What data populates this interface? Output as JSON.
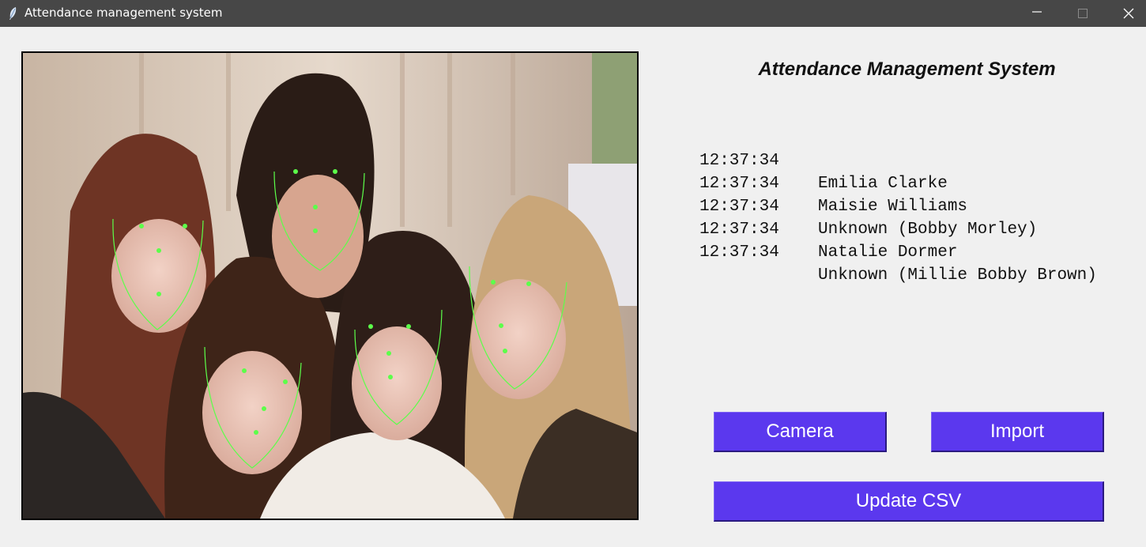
{
  "window": {
    "title": "Attendance management system",
    "icon": "feather-icon",
    "controls": [
      "minimize-icon",
      "maximize-icon",
      "close-icon"
    ]
  },
  "colors": {
    "titlebar": "#474747",
    "background": "#f0f0f0",
    "button": "#5b38ee",
    "button_text": "#ffffff",
    "landmarks": "#5cff4a"
  },
  "photo": {
    "subject": "group photo with facial landmarks detected",
    "faces_detected": 5
  },
  "main": {
    "heading": "Attendance Management System"
  },
  "attendance_log": [
    {
      "time": "12:37:34",
      "name": "Emilia Clarke"
    },
    {
      "time": "12:37:34",
      "name": "Maisie Williams"
    },
    {
      "time": "12:37:34",
      "name": "Unknown (Bobby Morley)"
    },
    {
      "time": "12:37:34",
      "name": "Natalie Dormer"
    },
    {
      "time": "12:37:34",
      "name": "Unknown (Millie Bobby Brown)"
    }
  ],
  "buttons": {
    "camera": "Camera",
    "import": "Import",
    "update_csv": "Update CSV"
  }
}
